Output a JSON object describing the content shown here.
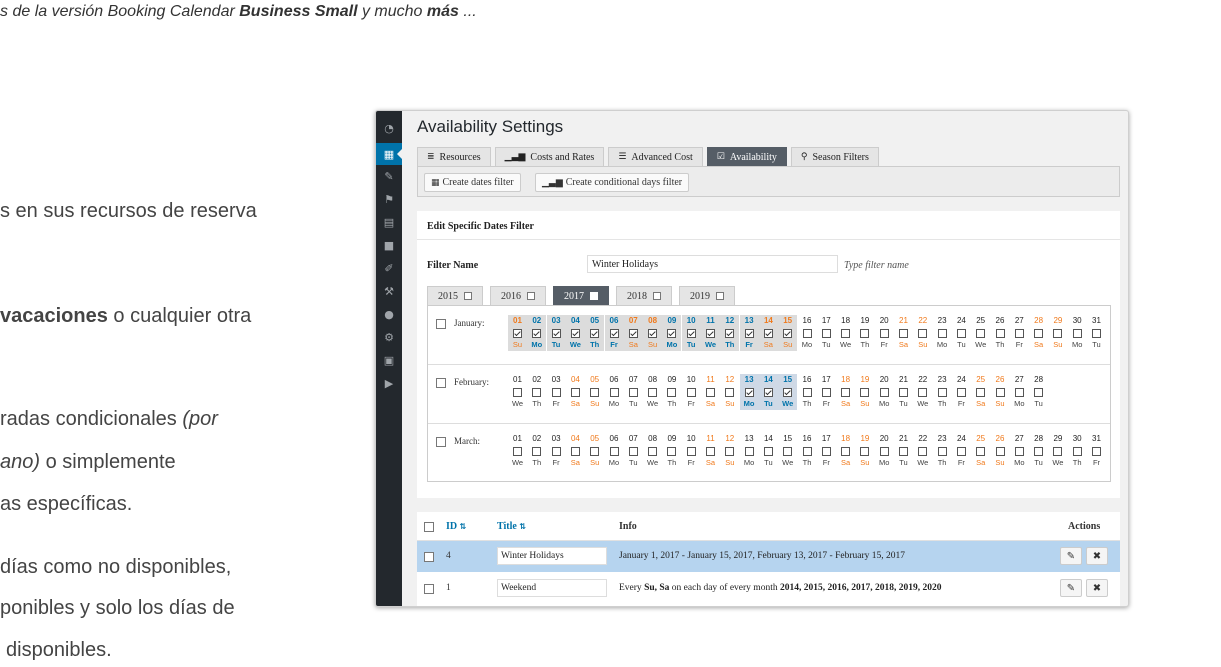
{
  "article": {
    "top_pre": "s de la versión Booking Calendar ",
    "top_b1": "Business Small",
    "top_mid": " y mucho ",
    "top_b2": "más",
    "top_post": " ...",
    "p1": "s en sus recursos de reserva",
    "p2_b": "vacaciones",
    "p2_post": " o cualquier otra",
    "p3_pre": "radas condicionales ",
    "p3_i": "(por",
    "p4_i": "ano)",
    "p4_post": " o simplemente",
    "p5": "as específicas.",
    "p6": "días como no disponibles,",
    "p7": "ponibles y solo los días de",
    "p8": "disponibles."
  },
  "screenshot": {
    "page_title": "Availability Settings",
    "sidebar_icons": [
      "dashboard-icon",
      "calendar-icon",
      "pin-icon",
      "translate-icon",
      "pages-icon",
      "comments-icon",
      "appearance-icon",
      "plugins-icon",
      "users-icon",
      "tools-icon",
      "settings-icon",
      "play-icon"
    ],
    "tabs": [
      {
        "label": "Resources",
        "icon": "≣",
        "active": false
      },
      {
        "label": "Costs and Rates",
        "icon": "▁▃▆",
        "active": false
      },
      {
        "label": "Advanced Cost",
        "icon": "☰",
        "active": false
      },
      {
        "label": "Availability",
        "icon": "☑",
        "active": true
      },
      {
        "label": "Season Filters",
        "icon": "⚲",
        "active": false
      }
    ],
    "sub_buttons": [
      {
        "label": "Create dates filter",
        "icon": "▦"
      },
      {
        "label": "Create conditional days filter",
        "icon": "▁▃▆"
      }
    ],
    "panel_title": "Edit Specific Dates Filter",
    "filter_name_label": "Filter Name",
    "filter_name_value": "Winter Holidays",
    "filter_name_hint": "Type filter name",
    "years": [
      {
        "label": "2015",
        "active": false
      },
      {
        "label": "2016",
        "active": false
      },
      {
        "label": "2017",
        "active": true
      },
      {
        "label": "2018",
        "active": false
      },
      {
        "label": "2019",
        "active": false
      }
    ],
    "months": [
      {
        "name": "January:",
        "first_dow": 0,
        "days": 31,
        "checked_to": 15,
        "highlight": []
      },
      {
        "name": "February:",
        "first_dow": 3,
        "days": 28,
        "checked_to": 0,
        "highlight": [
          13,
          14,
          15
        ]
      },
      {
        "name": "March:",
        "first_dow": 3,
        "days": 31,
        "checked_to": 0,
        "highlight": []
      }
    ],
    "weekday_abbr": [
      "Su",
      "Mo",
      "Tu",
      "We",
      "Th",
      "Fr",
      "Sa"
    ],
    "table": {
      "col_id": "ID",
      "col_id_icon": "⇅",
      "col_title": "Title",
      "col_title_icon": "⇅",
      "col_info": "Info",
      "col_actions": "Actions",
      "rows": [
        {
          "id": "4",
          "title": "Winter Holidays",
          "info_pre": "January 1, 2017 - January 15, 2017, February 13, 2017 - February 15, 2017",
          "info_b1": "",
          "info_mid": "",
          "info_b2": "",
          "info_post": "",
          "selected": true
        },
        {
          "id": "1",
          "title": "Weekend",
          "info_pre": "Every ",
          "info_b1": "Su, Sa",
          "info_mid": " on each day of every month ",
          "info_b2": "2014, 2015, 2016, 2017, 2018, 2019, 2020",
          "info_post": "",
          "selected": false
        }
      ],
      "edit_icon": "✎",
      "delete_icon": "✖"
    }
  }
}
